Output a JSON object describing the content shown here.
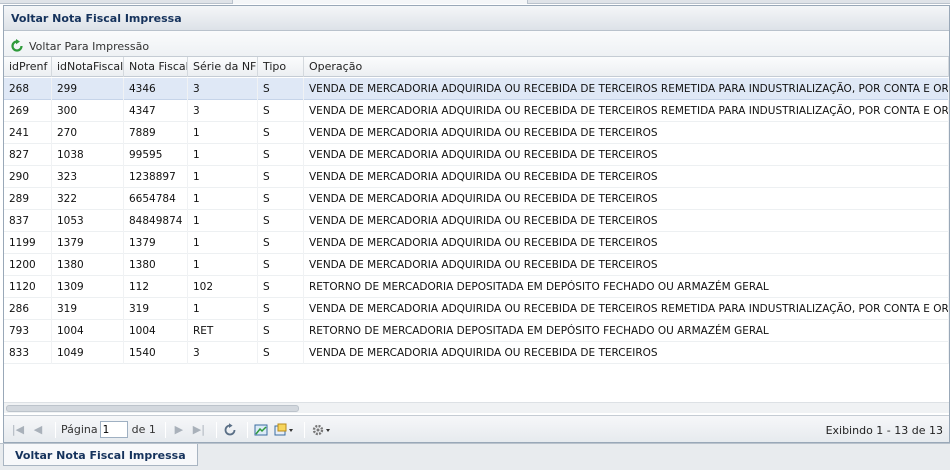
{
  "panel": {
    "title": "Voltar Nota Fiscal Impressa"
  },
  "toolbar": {
    "back_label": "Voltar Para Impressão",
    "back_icon": "refresh-arrow-icon"
  },
  "grid": {
    "columns": [
      "idPrenf",
      "idNotaFiscal",
      "Nota Fiscal",
      "Série da NF",
      "Tipo",
      "Operação"
    ],
    "rows": [
      [
        "268",
        "299",
        "4346",
        "3",
        "S",
        "VENDA DE MERCADORIA ADQUIRIDA OU RECEBIDA DE TERCEIROS REMETIDA PARA INDUSTRIALIZAÇÃO, POR CONTA E ORDEM DO ADQUIRENTE"
      ],
      [
        "269",
        "300",
        "4347",
        "3",
        "S",
        "VENDA DE MERCADORIA ADQUIRIDA OU RECEBIDA DE TERCEIROS REMETIDA PARA INDUSTRIALIZAÇÃO, POR CONTA E ORDEM DO ADQUIRENTE"
      ],
      [
        "241",
        "270",
        "7889",
        "1",
        "S",
        "VENDA DE MERCADORIA ADQUIRIDA OU RECEBIDA DE TERCEIROS"
      ],
      [
        "827",
        "1038",
        "99595",
        "1",
        "S",
        "VENDA DE MERCADORIA ADQUIRIDA OU RECEBIDA DE TERCEIROS"
      ],
      [
        "290",
        "323",
        "1238897",
        "1",
        "S",
        "VENDA DE MERCADORIA ADQUIRIDA OU RECEBIDA DE TERCEIROS"
      ],
      [
        "289",
        "322",
        "6654784",
        "1",
        "S",
        "VENDA DE MERCADORIA ADQUIRIDA OU RECEBIDA DE TERCEIROS"
      ],
      [
        "837",
        "1053",
        "84849874",
        "1",
        "S",
        "VENDA DE MERCADORIA ADQUIRIDA OU RECEBIDA DE TERCEIROS"
      ],
      [
        "1199",
        "1379",
        "1379",
        "1",
        "S",
        "VENDA DE MERCADORIA ADQUIRIDA OU RECEBIDA DE TERCEIROS"
      ],
      [
        "1200",
        "1380",
        "1380",
        "1",
        "S",
        "VENDA DE MERCADORIA ADQUIRIDA OU RECEBIDA DE TERCEIROS"
      ],
      [
        "1120",
        "1309",
        "112",
        "102",
        "S",
        "RETORNO DE MERCADORIA DEPOSITADA EM DEPÓSITO FECHADO OU ARMAZÉM GERAL"
      ],
      [
        "286",
        "319",
        "319",
        "1",
        "S",
        "VENDA DE MERCADORIA ADQUIRIDA OU RECEBIDA DE TERCEIROS REMETIDA PARA INDUSTRIALIZAÇÃO, POR CONTA E ORDEM DO ADQUIRENTE"
      ],
      [
        "793",
        "1004",
        "1004",
        "RET",
        "S",
        "RETORNO DE MERCADORIA DEPOSITADA EM DEPÓSITO FECHADO OU ARMAZÉM GERAL"
      ],
      [
        "833",
        "1049",
        "1540",
        "3",
        "S",
        "VENDA DE MERCADORIA ADQUIRIDA OU RECEBIDA DE TERCEIROS"
      ]
    ],
    "selected_row": 0
  },
  "pager": {
    "page_label": "Página",
    "page_value": "1",
    "of_label": "de 1",
    "display_text": "Exibindo 1 - 13 de 13"
  },
  "bottom_tab": {
    "label": "Voltar Nota Fiscal Impressa"
  },
  "colors": {
    "accent": "#15325c",
    "selected_row": "#dfe8f6",
    "back_icon": "#2e9a3a"
  }
}
